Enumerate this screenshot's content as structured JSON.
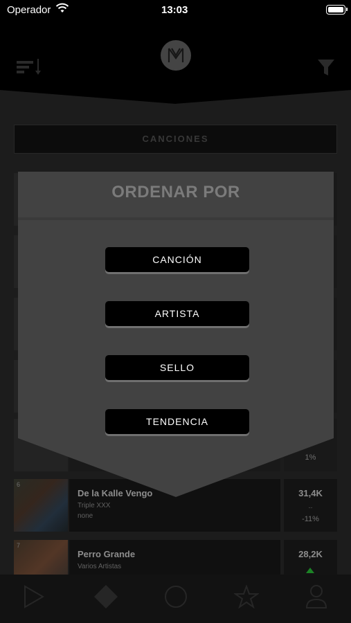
{
  "status_bar": {
    "carrier": "Operador",
    "time": "13:03"
  },
  "segment": {
    "label": "CANCIONES"
  },
  "rows": [
    {
      "rank": "6",
      "title": "De la Kalle Vengo",
      "artist": "Triple XXX",
      "label": "none",
      "count": "31,4K",
      "trend": "--",
      "pct": "-11%"
    },
    {
      "rank": "7",
      "title": "Perro Grande",
      "artist": "Varios Artistas",
      "count": "28,2K"
    }
  ],
  "partial_pct": "1%",
  "modal": {
    "title": "ORDENAR POR",
    "options": [
      "CANCIÓN",
      "ARTISTA",
      "SELLO",
      "TENDENCIA"
    ]
  },
  "tabbar": {
    "icons": [
      "play-icon",
      "diamond-icon",
      "circle-icon",
      "star-icon",
      "user-icon"
    ]
  },
  "colors": {
    "background": "#1f1f1f",
    "modal": "#424242",
    "button": "#000000",
    "accent_green": "#1f8f2a"
  }
}
